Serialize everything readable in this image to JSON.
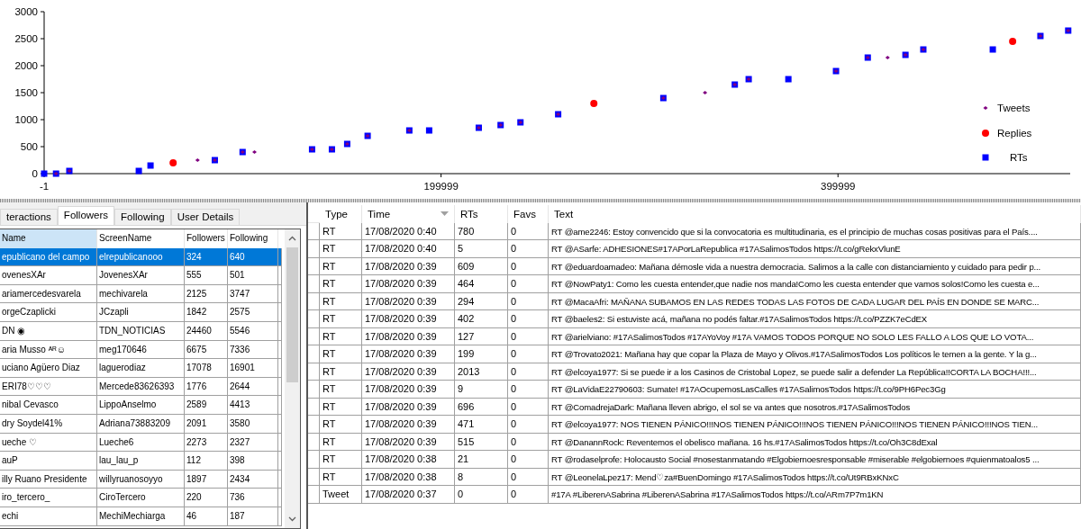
{
  "chart": {
    "chart_data": {
      "type": "scatter",
      "xlim": [
        -1,
        517000
      ],
      "ylim": [
        0,
        3000
      ],
      "xticks": [
        -1,
        199999,
        399999
      ],
      "yticks": [
        0,
        500,
        1000,
        1500,
        2000,
        2500,
        3000
      ],
      "x": [
        0,
        6000,
        12700,
        47700,
        53600,
        65000,
        77300,
        86000,
        100000,
        106000,
        135000,
        145000,
        152700,
        163000,
        184000,
        194000,
        219000,
        230000,
        240000,
        259000,
        277000,
        312000,
        333000,
        348000,
        355000,
        375000,
        399000,
        415000,
        425000,
        434000,
        443000,
        478000,
        488000,
        502000,
        516000
      ],
      "series": [
        {
          "name": "Tweets",
          "color": "#800080",
          "values": [
            null,
            0,
            50,
            null,
            null,
            null,
            250,
            250,
            400,
            400,
            450,
            450,
            550,
            700,
            800,
            null,
            850,
            900,
            950,
            1100,
            null,
            1400,
            1500,
            1650,
            1750,
            null,
            1900,
            2150,
            2150,
            2200,
            2300,
            null,
            null,
            2550,
            2650
          ]
        },
        {
          "name": "Replies",
          "color": "#ff0000",
          "values": [
            null,
            null,
            null,
            null,
            null,
            200,
            null,
            null,
            null,
            null,
            null,
            null,
            null,
            null,
            null,
            null,
            null,
            null,
            null,
            null,
            1300,
            null,
            null,
            null,
            null,
            null,
            null,
            null,
            null,
            null,
            null,
            null,
            2450,
            null,
            null
          ]
        },
        {
          "name": "RTs",
          "color": "#0000ff",
          "values": [
            0,
            0,
            50,
            50,
            150,
            null,
            null,
            250,
            400,
            null,
            450,
            450,
            550,
            700,
            800,
            800,
            850,
            900,
            950,
            1100,
            null,
            1400,
            null,
            1650,
            1750,
            1750,
            1900,
            2150,
            null,
            2200,
            2300,
            2300,
            null,
            2550,
            2650
          ]
        }
      ],
      "legend": "right"
    }
  },
  "left_panel": {
    "tabs": [
      {
        "label": "teractions",
        "selected": false
      },
      {
        "label": "Followers",
        "selected": true
      },
      {
        "label": "Following",
        "selected": false
      },
      {
        "label": "User Details",
        "selected": false
      }
    ],
    "columns": [
      "Name",
      "ScreenName",
      "Followers",
      "Following"
    ],
    "rows": [
      {
        "cells": [
          "epublicano del campo",
          "elrepublicanooo",
          "324",
          "640"
        ],
        "selected": true
      },
      {
        "cells": [
          "ovenesXAr",
          "JovenesXAr",
          "555",
          "501"
        ],
        "selected": false
      },
      {
        "cells": [
          "ariamercedesvarela",
          "mechivarela",
          "2125",
          "3747"
        ],
        "selected": false
      },
      {
        "cells": [
          "orgeCzaplicki",
          "JCzapli",
          "1842",
          "2575"
        ],
        "selected": false
      },
      {
        "cells": [
          "DN ◉",
          "TDN_NOTICIAS",
          "24460",
          "5546"
        ],
        "selected": false
      },
      {
        "cells": [
          "aria Musso ᴬᴿ☺",
          "meg170646",
          "6675",
          "7336"
        ],
        "selected": false
      },
      {
        "cells": [
          "uciano Agüero Diaz",
          "laguerodiaz",
          "17078",
          "16901"
        ],
        "selected": false
      },
      {
        "cells": [
          "ERI78♡♡♡",
          "Mercede83626393",
          "1776",
          "2644"
        ],
        "selected": false
      },
      {
        "cells": [
          "nibal Cevasco",
          "LippoAnselmo",
          "2589",
          "4413"
        ],
        "selected": false
      },
      {
        "cells": [
          "dry Soydel41%",
          "Adriana73883209",
          "2091",
          "3580"
        ],
        "selected": false
      },
      {
        "cells": [
          "ueche ♡",
          "Lueche6",
          "2273",
          "2327"
        ],
        "selected": false
      },
      {
        "cells": [
          "auP",
          "lau_lau_p",
          "112",
          "398"
        ],
        "selected": false
      },
      {
        "cells": [
          "illy Ruano Presidente",
          "willyruanosoyyo",
          "1897",
          "2434"
        ],
        "selected": false
      },
      {
        "cells": [
          "iro_tercero_",
          "CiroTercero",
          "220",
          "736"
        ],
        "selected": false
      },
      {
        "cells": [
          "echi",
          "MechiMechiarga",
          "46",
          "187"
        ],
        "selected": false
      }
    ]
  },
  "right_panel": {
    "columns": [
      "Type",
      "Time",
      "RTs",
      "Favs",
      "Text"
    ],
    "rows": [
      [
        "RT",
        "17/08/2020 0:40",
        "780",
        "0",
        "RT @ame2246: Estoy convencido que si la convocatoria es multitudinaria, es el principio de muchas cosas positivas para el País...."
      ],
      [
        "RT",
        "17/08/2020 0:40",
        "5",
        "0",
        "RT @ASarfe: ADHESIONES#17APorLaRepublica #17ASalimosTodos https://t.co/gRekxVlunE"
      ],
      [
        "RT",
        "17/08/2020 0:39",
        "609",
        "0",
        "RT @eduardoamadeo: Mañana démosle vida a nuestra democracia. Salimos a la calle con distanciamiento y cuidado para pedir p..."
      ],
      [
        "RT",
        "17/08/2020 0:39",
        "464",
        "0",
        "RT @NowPaty1: Como les cuesta entender,que nadie nos manda!Como les cuesta entender que vamos solos!Como les cuesta e..."
      ],
      [
        "RT",
        "17/08/2020 0:39",
        "294",
        "0",
        "RT @MacaAfri: MAÑANA SUBAMOS EN LAS REDES TODAS LAS FOTOS DE CADA LUGAR DEL PAÍS EN DONDE SE MARC..."
      ],
      [
        "RT",
        "17/08/2020 0:39",
        "402",
        "0",
        "RT @baeles2: Si estuviste acá, mañana no podés faltar.#17ASalimosTodos https://t.co/PZZK7eCdEX"
      ],
      [
        "RT",
        "17/08/2020 0:39",
        "127",
        "0",
        "RT @arielviano: #17ASalimosTodos #17AYoVoy #17A VAMOS TODOS PORQUE NO SOLO LES FALLO A LOS QUE LO VOTA..."
      ],
      [
        "RT",
        "17/08/2020 0:39",
        "199",
        "0",
        "RT @Trovato2021: Mañana hay que copar la Plaza de Mayo y Olivos.#17ASalimosTodos Los políticos le temen a la gente. Y la g..."
      ],
      [
        "RT",
        "17/08/2020 0:39",
        "2013",
        "0",
        "RT @elcoya1977: Si se puede ir a los Casinos de Cristobal Lopez, se puede salir a defender La República!!CORTA LA BOCHA!!!..."
      ],
      [
        "RT",
        "17/08/2020 0:39",
        "9",
        "0",
        "RT @LaVidaE22790603: Sumate! #17AOcupemosLasCalles #17ASalimosTodos https://t.co/9PH6Pec3Gg"
      ],
      [
        "RT",
        "17/08/2020 0:39",
        "696",
        "0",
        "RT @ComadrejaDark: Mañana lleven abrigo, el sol se va antes que nosotros.#17ASalimosTodos"
      ],
      [
        "RT",
        "17/08/2020 0:39",
        "471",
        "0",
        "RT @elcoya1977: NOS TIENEN PÁNICO!!!NOS TIENEN PÁNICO!!!NOS TIENEN PÁNICO!!!NOS TIENEN PÁNICO!!!NOS TIEN..."
      ],
      [
        "RT",
        "17/08/2020 0:39",
        "515",
        "0",
        "RT @DanannRock: Reventemos el obelisco mañana. 16 hs.#17ASalimosTodos https://t.co/Oh3C8dExal"
      ],
      [
        "RT",
        "17/08/2020 0:38",
        "21",
        "0",
        "RT @rodaselprofe: Holocausto Social #nosestanmatando #Elgobiernoesresponsable #miserable #elgobiernoes #quienmatoalos5 ..."
      ],
      [
        "RT",
        "17/08/2020 0:38",
        "8",
        "0",
        "RT @LeonelaLpez17: Mend♡za#BuenDomingo #17ASalimosTodos https://t.co/Ut9RBxKNxC"
      ],
      [
        "Tweet",
        "17/08/2020 0:37",
        "0",
        "0",
        "#17A #LiberenASabrina #LiberenASabrina #17ASalimosTodos https://t.co/ARm7P7m1KN"
      ]
    ]
  }
}
